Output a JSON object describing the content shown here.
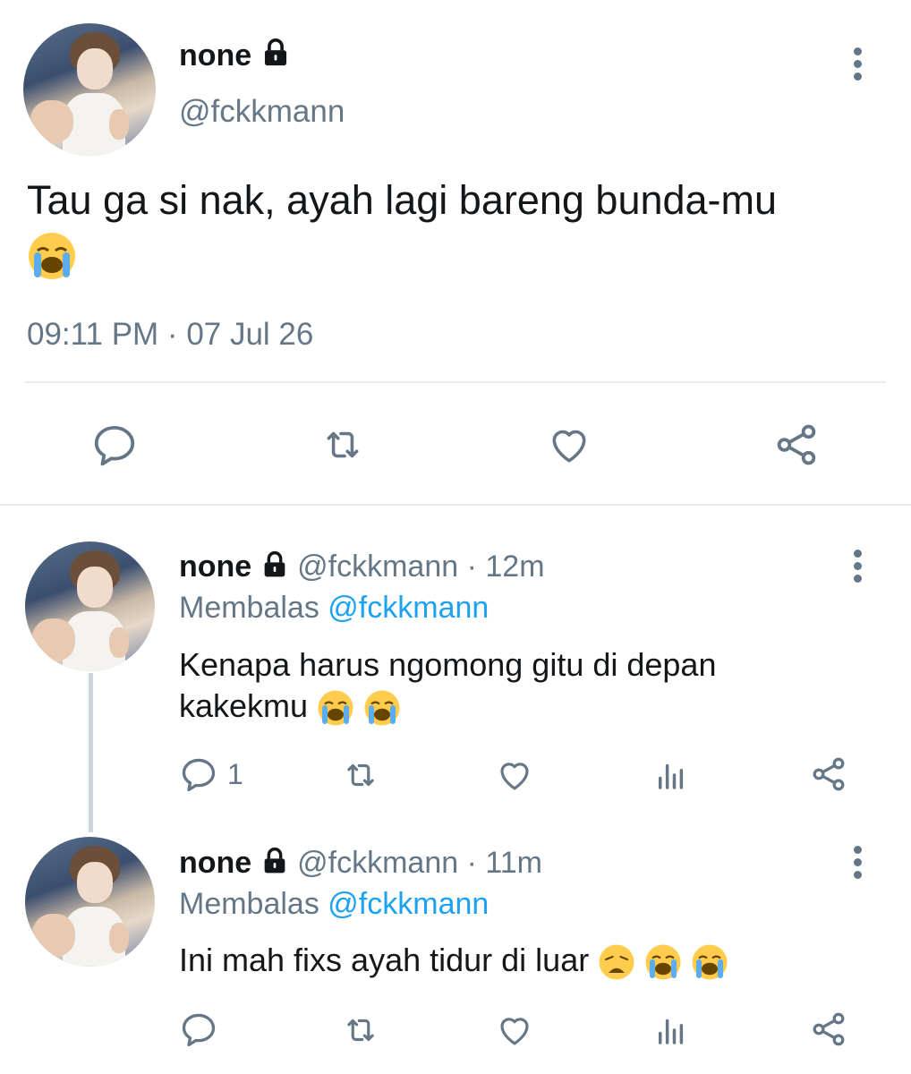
{
  "main_tweet": {
    "name": "none",
    "handle": "@fckkmann",
    "text": "Tau ga si nak, ayah lagi bareng bunda-mu",
    "timestamp": "09:11 PM · 07 Jul 26"
  },
  "replies": [
    {
      "name": "none",
      "handle": "@fckkmann",
      "time": "12m",
      "replying_label": "Membalas",
      "replying_to": "@fckkmann",
      "text_line1": "Kenapa harus ngomong gitu di depan",
      "text_line2": "kakekmu",
      "reply_count": "1"
    },
    {
      "name": "none",
      "handle": "@fckkmann",
      "time": "11m",
      "replying_label": "Membalas",
      "replying_to": "@fckkmann",
      "text_line1": "Ini mah fixs ayah tidur di luar",
      "reply_count": ""
    }
  ],
  "icons": {
    "reply": "reply-icon",
    "retweet": "retweet-icon",
    "like": "like-icon",
    "analytics": "analytics-icon",
    "share": "share-icon",
    "lock": "lock-icon",
    "more": "more-options-icon",
    "emoji_cry": "loudly-crying-face",
    "emoji_weary": "weary-face"
  },
  "colors": {
    "text": "#14171a",
    "secondary": "#657786",
    "link": "#1da1f2",
    "divider": "#e6ecf0"
  }
}
